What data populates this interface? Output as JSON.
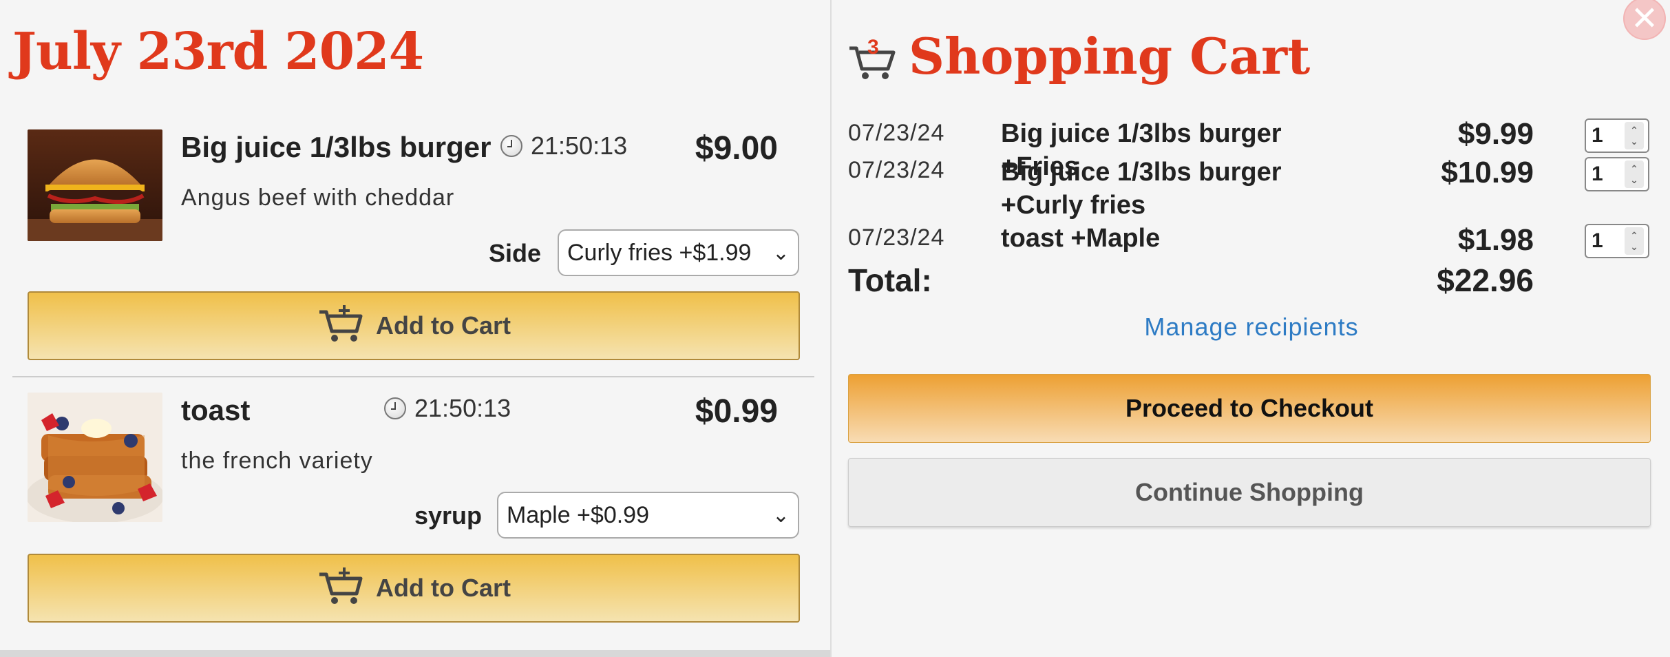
{
  "menu": {
    "date_title": "July 23rd 2024",
    "items": [
      {
        "name": "Big juice 1/3lbs burger",
        "time": "21:50:13",
        "price": "$9.00",
        "description": "Angus beef with cheddar",
        "option_label": "Side",
        "option_selected": "Curly fries +$1.99",
        "add_label": "Add to Cart",
        "image": "burger-photo"
      },
      {
        "name": "toast",
        "time": "21:50:13",
        "price": "$0.99",
        "description": "the french variety",
        "option_label": "syrup",
        "option_selected": "Maple +$0.99",
        "add_label": "Add to Cart",
        "image": "french-toast-photo"
      }
    ]
  },
  "cart": {
    "title": "Shopping Cart",
    "count": "3",
    "rows": [
      {
        "date": "07/23/24",
        "name": "Big juice 1/3lbs burger +Fries",
        "price": "$9.99",
        "qty": "1"
      },
      {
        "date": "07/23/24",
        "name": "Big juice 1/3lbs burger +Curly fries",
        "price": "$10.99",
        "qty": "1"
      },
      {
        "date": "07/23/24",
        "name": "toast +Maple",
        "price": "$1.98",
        "qty": "1"
      }
    ],
    "total_label": "Total:",
    "total_value": "$22.96",
    "manage_link": "Manage recipients",
    "checkout_label": "Proceed to Checkout",
    "continue_label": "Continue Shopping"
  },
  "colors": {
    "accent_red": "#e0391c",
    "add_button": "#f0c04a",
    "checkout_button": "#eda033",
    "link_blue": "#2d7bc4"
  }
}
